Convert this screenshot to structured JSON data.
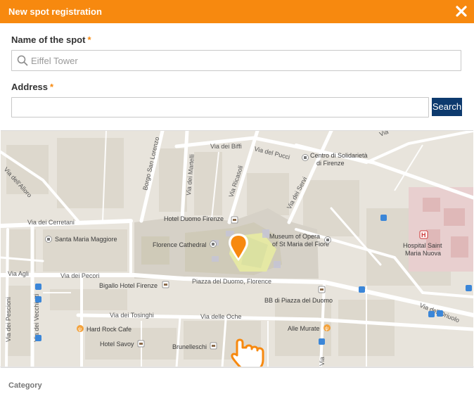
{
  "dialog": {
    "title": "New spot registration",
    "close_icon": "close-icon"
  },
  "name_field": {
    "label": "Name of the spot",
    "required_mark": "*",
    "placeholder": "Eiffel Tower",
    "value": ""
  },
  "address_field": {
    "label": "Address",
    "required_mark": "*",
    "placeholder": "",
    "value": ""
  },
  "search_button": {
    "label": "Search"
  },
  "map": {
    "street_labels": {
      "via_dei_biffi": "Via dei Biffi",
      "via_del_pucci": "Via del Pucci",
      "borgo_san_lorenzo": "Borgo San Lorenzo",
      "via_dei_martelli": "Via dei Martelli",
      "via_ricasoli": "Via Ricasoli",
      "via_dei_servi": "Via dei Servi",
      "via_dellalloro": "Via dell'Alloro",
      "via_dei_cerretani": "Via dei Cerretani",
      "via_dei_pecori": "Via dei Pecori",
      "via_agli": "Via Agli",
      "piazza_del_duomo": "Piazza del Duomo, Florence",
      "via_dei_tosinghi": "Via dei Tosinghi",
      "via_delle_oche": "Via delle Oche",
      "via_dei_pescioni": "Via dei Pescioni",
      "via_dei_vecchietti": "Via dei Vecchietti",
      "via_dellorivolo": "Via dell'Oriuolo",
      "via_top_right": "Via",
      "via_bottom": "Via"
    },
    "places": {
      "centro": "Centro di Solidarietà",
      "centro2": "di Firenze",
      "hotel_duomo": "Hotel Duomo Firenze",
      "santa_maria": "Santa Maria Maggiore",
      "cathedral": "Florence Cathedral",
      "museum1": "Museum of Opera",
      "museum2": "of St Maria del Fiore",
      "hospital1": "Hospital Saint",
      "hospital2": "Maria Nuova",
      "bigallo": "Bigallo Hotel Firenze",
      "bb": "BB di Piazza del Duomo",
      "hard_rock": "Hard Rock Cafe",
      "alle_murate": "Alle Murate",
      "hotel_savoy": "Hotel Savoy",
      "brunelleschi": "Brunelleschi"
    },
    "marker_color": "#f7890f"
  },
  "category": {
    "label": "Category"
  },
  "colors": {
    "title_bar": "#f7890f",
    "search_button": "#0d3a6e",
    "required": "#f7890f"
  }
}
